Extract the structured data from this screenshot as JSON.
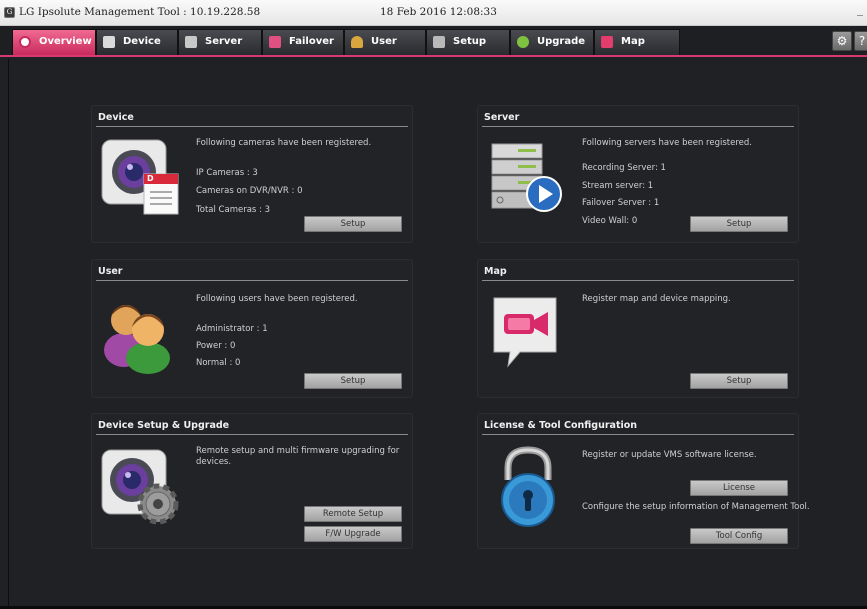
{
  "window": {
    "title": "LG Ipsolute Management Tool : 10.19.228.58",
    "datetime": "18 Feb 2016 12:08:33",
    "minimize_glyph": "_"
  },
  "tabs": [
    {
      "label": "Overview",
      "icon": "overview-icon",
      "active": true
    },
    {
      "label": "Device",
      "icon": "device-icon",
      "active": false
    },
    {
      "label": "Server",
      "icon": "server-icon",
      "active": false
    },
    {
      "label": "Failover",
      "icon": "failover-icon",
      "active": false
    },
    {
      "label": "User",
      "icon": "user-icon",
      "active": false
    },
    {
      "label": "Setup",
      "icon": "setup-icon",
      "active": false
    },
    {
      "label": "Upgrade",
      "icon": "upgrade-icon",
      "active": false
    },
    {
      "label": "Map",
      "icon": "map-icon",
      "active": false
    }
  ],
  "toolbar": {
    "settings_icon": "gear-icon",
    "help_label": "?"
  },
  "colors": {
    "accent": "#d83a6f",
    "background": "#202125",
    "button": "#b8b8b8"
  },
  "cards": {
    "device": {
      "title": "Device",
      "lines": [
        "Following cameras have been registered.",
        "IP Cameras : 3",
        "Cameras on DVR/NVR : 0",
        "Total Cameras : 3"
      ],
      "button": "Setup",
      "icon": "camera-document-icon",
      "badge": "D"
    },
    "server": {
      "title": "Server",
      "lines": [
        "Following servers have been registered.",
        "Recording Server: 1",
        "Stream server: 1",
        "Failover Server : 1",
        "Video Wall: 0"
      ],
      "button": "Setup",
      "icon": "server-play-icon"
    },
    "user": {
      "title": "User",
      "lines": [
        "Following users have been registered.",
        "Administrator : 1",
        "Power : 0",
        "Normal : 0"
      ],
      "button": "Setup",
      "icon": "users-icon"
    },
    "map": {
      "title": "Map",
      "lines": [
        "Register map and device mapping."
      ],
      "button": "Setup",
      "icon": "video-camera-bubble-icon"
    },
    "device_setup": {
      "title": "Device Setup & Upgrade",
      "lines": [
        "Remote setup and multi firmware upgrading for devices."
      ],
      "buttons": [
        "Remote Setup",
        "F/W Upgrade"
      ],
      "icon": "camera-gear-icon"
    },
    "license": {
      "title": "License & Tool Configuration",
      "lines": [
        "Register or update VMS software license.",
        "Configure the setup information of Management Tool."
      ],
      "buttons": [
        "License",
        "Tool Config"
      ],
      "icon": "padlock-icon"
    }
  }
}
